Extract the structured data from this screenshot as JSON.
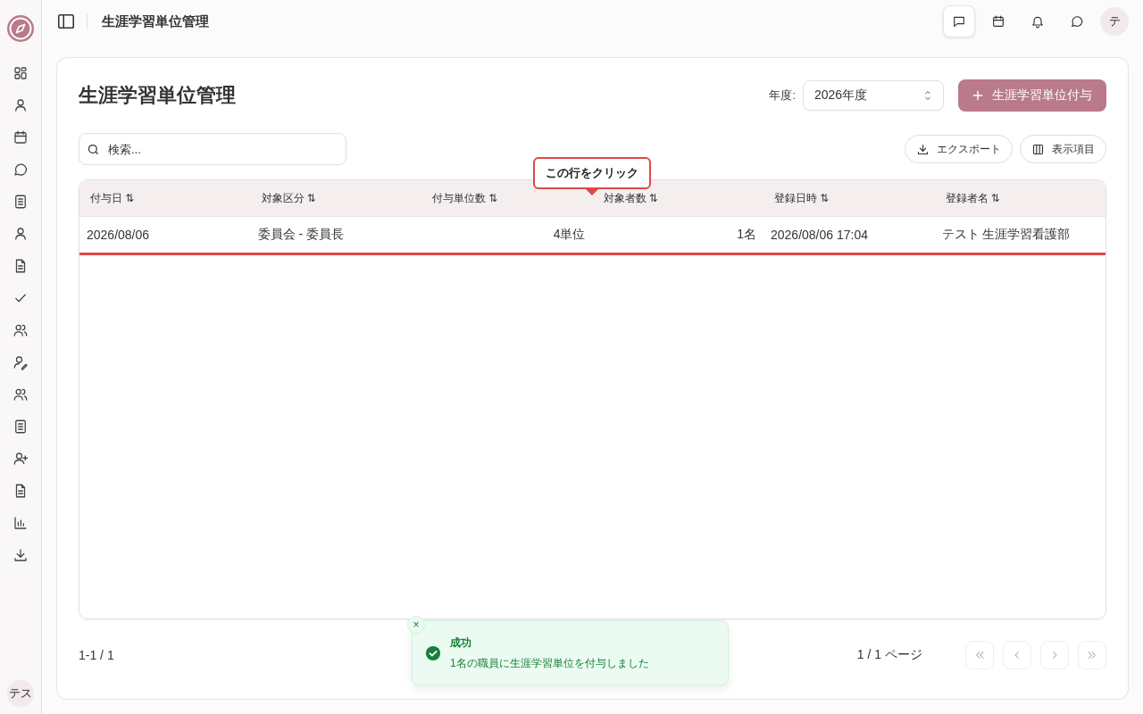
{
  "topbar": {
    "title": "生涯学習単位管理",
    "actions": [
      {
        "selected": true
      },
      {
        "selected": false
      },
      {
        "selected": false
      },
      {
        "selected": false
      }
    ],
    "avatar": "テ"
  },
  "sidebar": {
    "avatar": "テス"
  },
  "page": {
    "title": "生涯学習単位管理",
    "year_label": "年度:",
    "year_select": {
      "value": "2026年度"
    },
    "add_button": "生涯学習単位付与"
  },
  "search": {
    "placeholder": "検索..."
  },
  "toolbar": {
    "export": "エクスポート",
    "columns": "表示項目"
  },
  "table": {
    "columns": [
      {
        "label": "付与日 ⇅"
      },
      {
        "label": "対象区分 ⇅"
      },
      {
        "label": "付与単位数 ⇅"
      },
      {
        "label": "対象者数 ⇅"
      },
      {
        "label": "登録日時 ⇅"
      },
      {
        "label": "登録者名 ⇅"
      }
    ],
    "rows": [
      {
        "selected": true,
        "cells": [
          "2026/08/06",
          "委員会 - 委員長",
          "4単位",
          "1名",
          "2026/08/06 17:04",
          "テスト 生涯学習看護部"
        ]
      }
    ]
  },
  "tooltip": {
    "text": "この行をクリック"
  },
  "footer": {
    "range": "1-1 / 1",
    "page_info": "1 / 1 ページ",
    "pager": [
      {
        "kind": "first",
        "disabled": true
      },
      {
        "kind": "prev",
        "disabled": true
      },
      {
        "kind": "next",
        "disabled": true
      },
      {
        "kind": "last",
        "disabled": true
      }
    ]
  },
  "toast": {
    "close": "×",
    "title": "成功",
    "message": "1名の職員に生涯学習単位を付与しました"
  }
}
